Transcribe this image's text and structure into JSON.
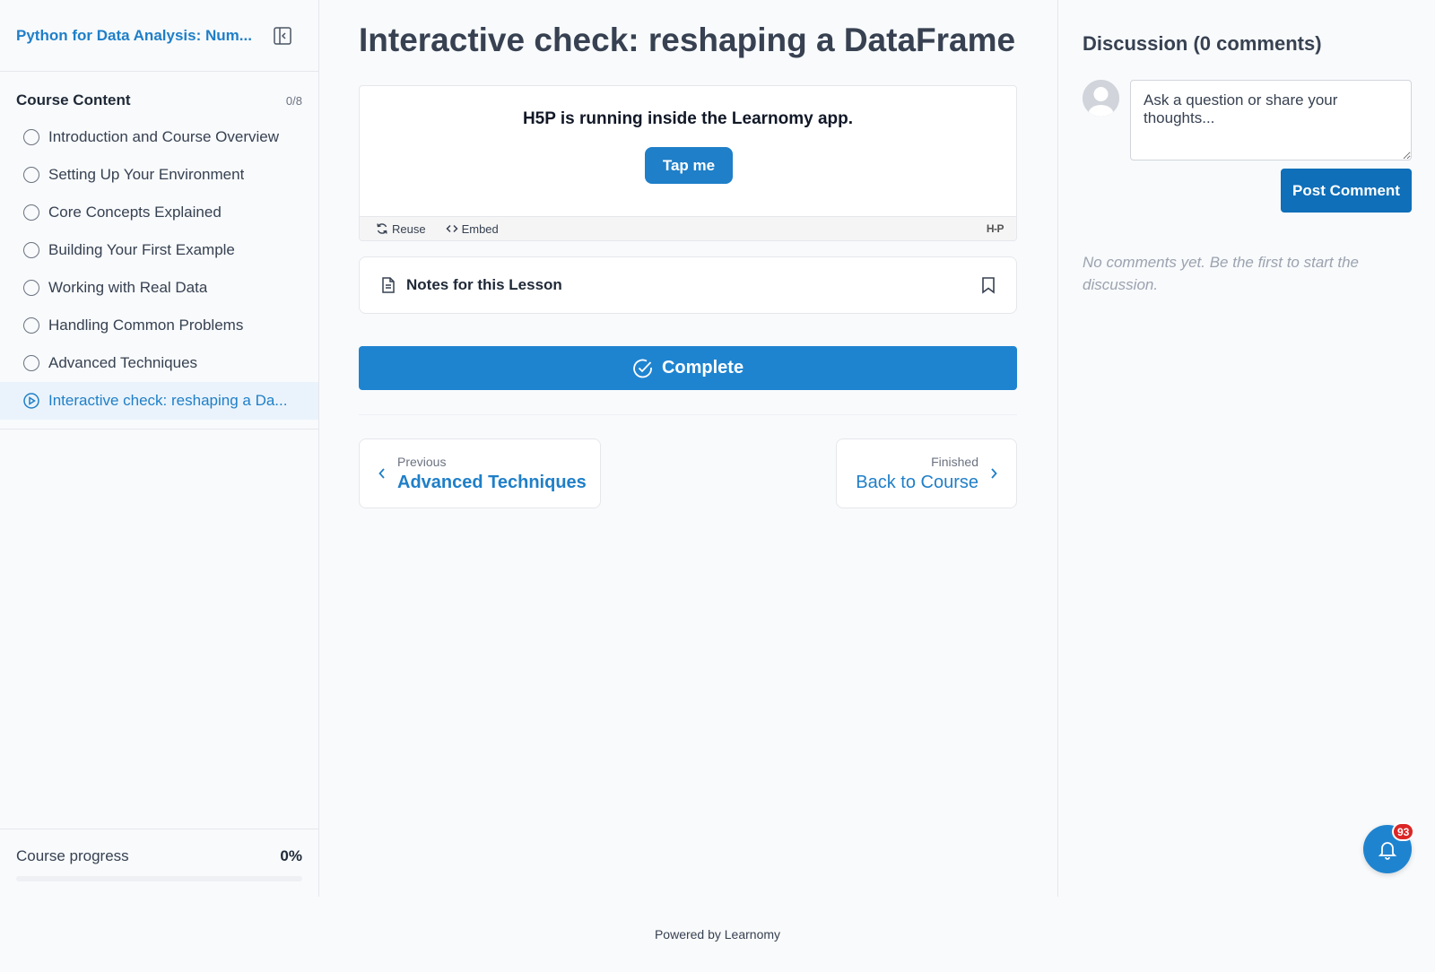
{
  "sidebar": {
    "course_title": "Python for Data Analysis: Num...",
    "content_label": "Course Content",
    "content_count": "0/8",
    "lessons": [
      {
        "label": "Introduction and Course Overview"
      },
      {
        "label": "Setting Up Your Environment"
      },
      {
        "label": "Core Concepts Explained"
      },
      {
        "label": "Building Your First Example"
      },
      {
        "label": "Working with Real Data"
      },
      {
        "label": "Handling Common Problems"
      },
      {
        "label": "Advanced Techniques"
      },
      {
        "label": "Interactive check: reshaping a Da..."
      }
    ],
    "progress_label": "Course progress",
    "progress_value": "0%",
    "progress_fraction": 0
  },
  "main": {
    "title": "Interactive check: reshaping a DataFrame",
    "h5p": {
      "message": "H5P is running inside the Learnomy app.",
      "tap_label": "Tap me",
      "reuse_label": "Reuse",
      "embed_label": "Embed",
      "logo": "H-P"
    },
    "notes_label": "Notes for this Lesson",
    "complete_label": "Complete",
    "prev": {
      "sub": "Previous",
      "title": "Advanced Techniques"
    },
    "next": {
      "sub": "Finished",
      "title": "Back to Course"
    }
  },
  "discussion": {
    "title": "Discussion (0 comments)",
    "placeholder": "Ask a question or share your thoughts...",
    "post_label": "Post Comment",
    "empty_text": "No comments yet. Be the first to start the discussion."
  },
  "notifications": {
    "badge": "93"
  },
  "footer": {
    "text": "Powered by Learnomy"
  },
  "colors": {
    "accent": "#1f7fc8",
    "button": "#1f84d0",
    "badge": "#dc2626"
  }
}
